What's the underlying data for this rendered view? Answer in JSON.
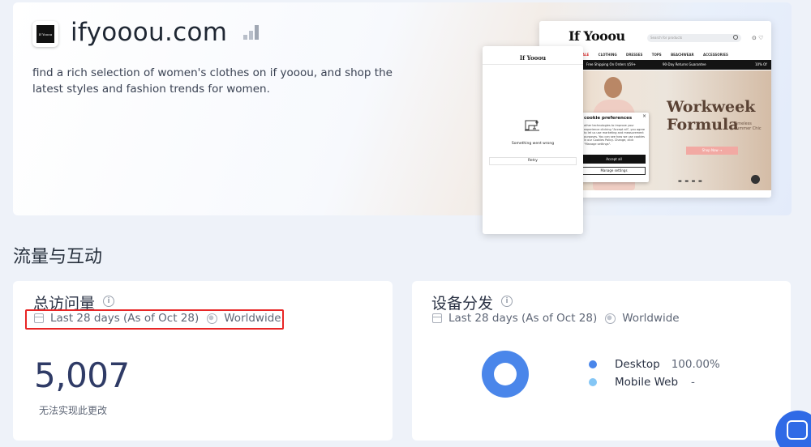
{
  "site": {
    "title": "ifyooou.com",
    "logo_text": "If Yooou",
    "description": "find a rich selection of women's clothes on if yooou, and shop the latest styles and fashion trends for women."
  },
  "preview_back": {
    "brand": "If Yooou",
    "search_placeholder": "Search for products",
    "nav": [
      "SALE",
      "CLOTHING",
      "DRESSES",
      "TOPS",
      "BEACHWEAR",
      "ACCESSORIES"
    ],
    "strip": [
      "Free Shipping On Orders $59+",
      "90-Day Returns Guarantee",
      "10% Of"
    ],
    "headline_1": "Workweek",
    "headline_2": "Formula",
    "subline": "Timeless Summer Chic",
    "shop_button": "Shop Now →",
    "cookie": {
      "title": "cookie preferences",
      "body": "other technologies to improve your experience clicking \"Accept all\", you agree to let us use marketing and measurement purposes. You can see how we use cookies in our Cookies Policy. Change, click \"Manage settings\".",
      "accept": "Accept all",
      "manage": "Manage settings"
    }
  },
  "preview_front": {
    "brand": "If Yooou",
    "error": "Something went wrong",
    "retry": "Retry"
  },
  "section": {
    "title": "流量与互动"
  },
  "visits_card": {
    "title": "总访问量",
    "period": "Last 28 days (As of Oct 28)",
    "region": "Worldwide",
    "value": "5,007",
    "note": "无法实现此更改"
  },
  "device_card": {
    "title": "设备分发",
    "period": "Last 28 days (As of Oct 28)",
    "region": "Worldwide",
    "legend": [
      {
        "label": "Desktop",
        "value": "100.00%",
        "color": "#4a86ea"
      },
      {
        "label": "Mobile Web",
        "value": "-",
        "color": "#84c6f5"
      }
    ]
  },
  "chart_data": {
    "type": "pie",
    "categories": [
      "Desktop",
      "Mobile Web"
    ],
    "values": [
      100.0,
      0
    ]
  },
  "colors": {
    "accent": "#4a86ea",
    "highlight_border": "#e82626",
    "fab": "#2f6ae6"
  }
}
